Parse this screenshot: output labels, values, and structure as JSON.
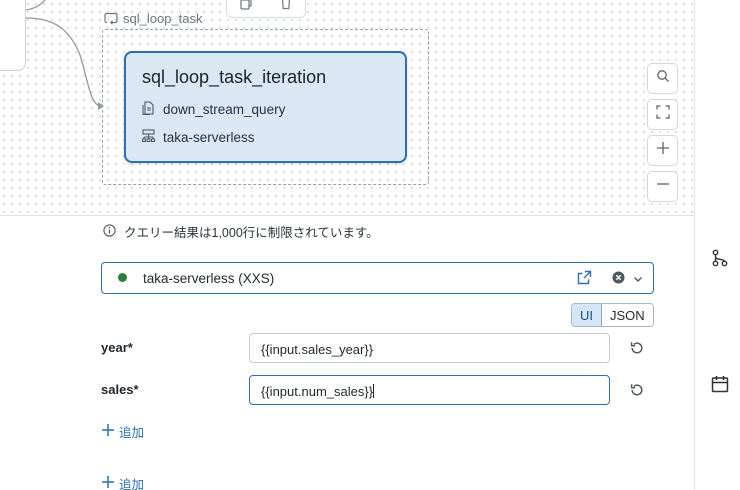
{
  "canvas": {
    "loop_task_label": "sql_loop_task",
    "task_card": {
      "title": "sql_loop_task_iteration",
      "query_name": "down_stream_query",
      "compute_name": "taka-serverless"
    },
    "zoom_controls": [
      "search-icon",
      "fit-view-icon",
      "zoom-in-icon",
      "zoom-out-icon"
    ]
  },
  "panel": {
    "info_message": "クエリー結果は1,000行に制限されています。",
    "warehouse": {
      "name": "taka-serverless (XXS)",
      "status_color": "#2e7d3a"
    },
    "mode_toggle": {
      "options": [
        "UI",
        "JSON"
      ],
      "selected": "UI"
    },
    "parameters": [
      {
        "name": "year*",
        "value": "{{input.sales_year}}"
      },
      {
        "name": "sales*",
        "value": "{{input.num_sales}}"
      }
    ],
    "add_parameter_label": "追加",
    "add_other_label": "追加"
  },
  "right_rail": {
    "icons": [
      "workflow-icon",
      "calendar-icon"
    ]
  },
  "colors": {
    "accent": "#2d6fb3",
    "card_fill": "#dbe8f4",
    "link": "#2a6fb0"
  }
}
